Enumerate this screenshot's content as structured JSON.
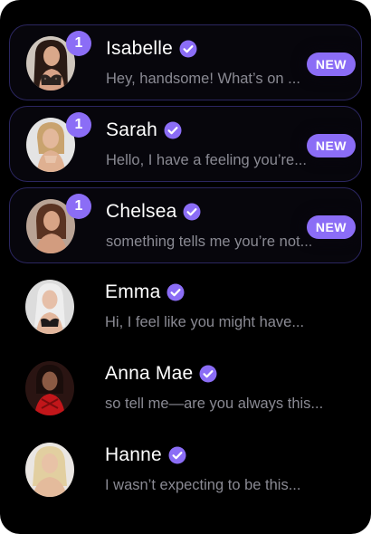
{
  "colors": {
    "background": "#000000",
    "accent": "#8b6df6",
    "unread_border": "#2b2660",
    "name_text": "#ffffff",
    "preview_text": "#8a8a93"
  },
  "chats": [
    {
      "name": "Isabelle",
      "verified": true,
      "unread_count": "1",
      "new_label": "NEW",
      "preview": "Hey, handsome! What’s on ..."
    },
    {
      "name": "Sarah",
      "verified": true,
      "unread_count": "1",
      "new_label": "NEW",
      "preview": "Hello, I have a feeling you’re..."
    },
    {
      "name": "Chelsea",
      "verified": true,
      "unread_count": "1",
      "new_label": "NEW",
      "preview": "something tells me you’re not..."
    },
    {
      "name": "Emma",
      "verified": true,
      "preview": "Hi, I feel like you might have..."
    },
    {
      "name": "Anna Mae",
      "verified": true,
      "preview": "so tell me—are you always this..."
    },
    {
      "name": "Hanne",
      "verified": true,
      "preview": "I wasn’t expecting to be this..."
    }
  ]
}
